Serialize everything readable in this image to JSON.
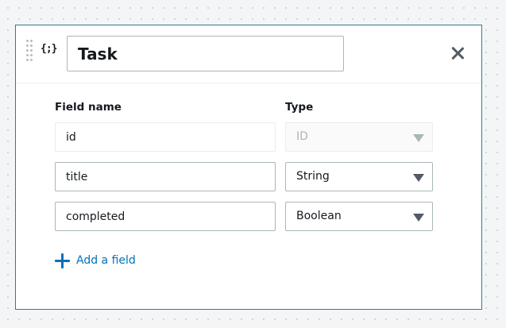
{
  "model": {
    "type_icon": "{;}",
    "name": "Task",
    "close_icon": "close-icon"
  },
  "columns": {
    "field_name": "Field name",
    "type": "Type"
  },
  "fields": [
    {
      "name": "id",
      "type": "ID",
      "editable": false
    },
    {
      "name": "title",
      "type": "String",
      "editable": true
    },
    {
      "name": "completed",
      "type": "Boolean",
      "editable": true
    }
  ],
  "actions": {
    "add_field": "Add a field"
  },
  "colors": {
    "accent": "#0073bb",
    "card_border": "#2b7b9a",
    "input_border": "#aab7b8",
    "text": "#16191f",
    "muted": "#aab7b8"
  }
}
